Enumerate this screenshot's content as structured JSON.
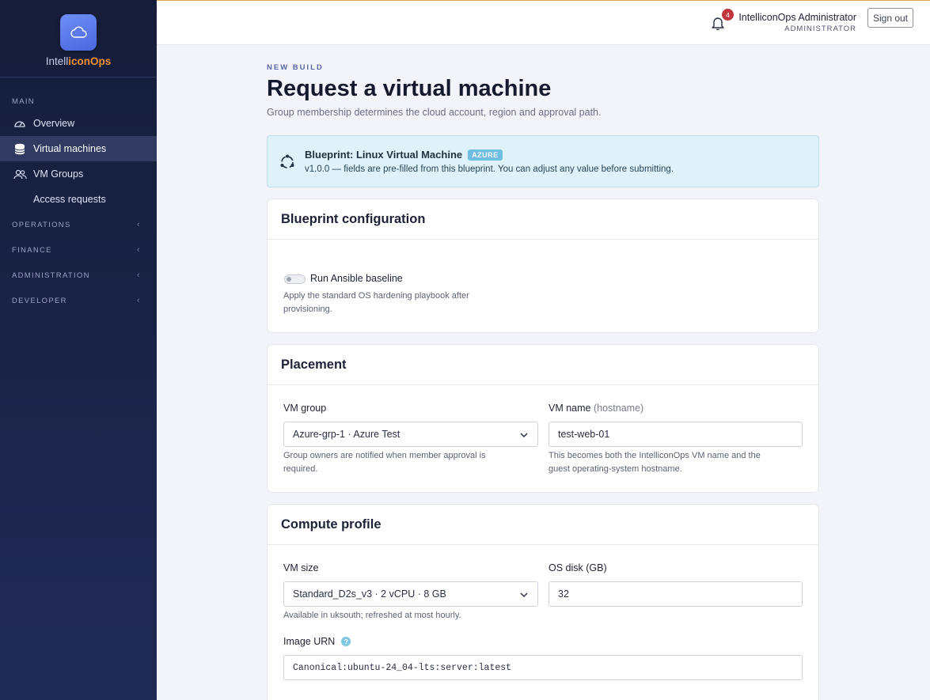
{
  "brand": {
    "name_prefix": "Intell",
    "name_accent": "iconOps"
  },
  "sidebar": {
    "main_label": "MAIN",
    "items": [
      {
        "label": "Overview",
        "icon": "gauge-icon"
      },
      {
        "label": "Virtual machines",
        "icon": "database-icon"
      },
      {
        "label": "VM Groups",
        "icon": "users-icon"
      },
      {
        "label": "Access requests"
      }
    ],
    "sections": [
      {
        "label": "OPERATIONS"
      },
      {
        "label": "FINANCE"
      },
      {
        "label": "ADMINISTRATION"
      },
      {
        "label": "DEVELOPER"
      }
    ]
  },
  "topbar": {
    "notification_count": "4",
    "user_name": "IntelliconOps Administrator",
    "user_role": "ADMINISTRATOR",
    "signout_label": "Sign out"
  },
  "page": {
    "kicker": "NEW BUILD",
    "title": "Request a virtual machine",
    "subtitle": "Group membership determines the cloud account, region and approval path."
  },
  "blueprint_info": {
    "title": "Blueprint: Linux Virtual Machine",
    "badge": "AZURE",
    "text": "v1.0.0 — fields are pre-filled from this blueprint. You can adjust any value before submitting."
  },
  "blueprint_config": {
    "heading": "Blueprint configuration",
    "toggle_label": "Run Ansible baseline",
    "toggle_on": false,
    "help_line1": "Apply the standard OS hardening playbook after",
    "help_line2": "provisioning."
  },
  "placement": {
    "heading": "Placement",
    "group_label": "VM group",
    "group_value": "Azure-grp-1 · Azure Test",
    "group_help_line1": "Group owners are notified when member approval is",
    "group_help_line2": "required.",
    "name_label": "VM name",
    "name_label_hint": "(hostname)",
    "name_value": "test-web-01",
    "name_help_line1": "This becomes both the IntelliconOps VM name and the",
    "name_help_line2": "guest operating-system hostname."
  },
  "compute": {
    "heading": "Compute profile",
    "size_label": "VM size",
    "size_value": "Standard_D2s_v3 · 2 vCPU · 8 GB",
    "size_help": "Available in uksouth; refreshed at most hourly.",
    "disk_label": "OS disk (GB)",
    "disk_value": "32",
    "image_label": "Image URN",
    "image_help_glyph": "?",
    "image_value": "Canonical:ubuntu-24_04-lts:server:latest"
  }
}
